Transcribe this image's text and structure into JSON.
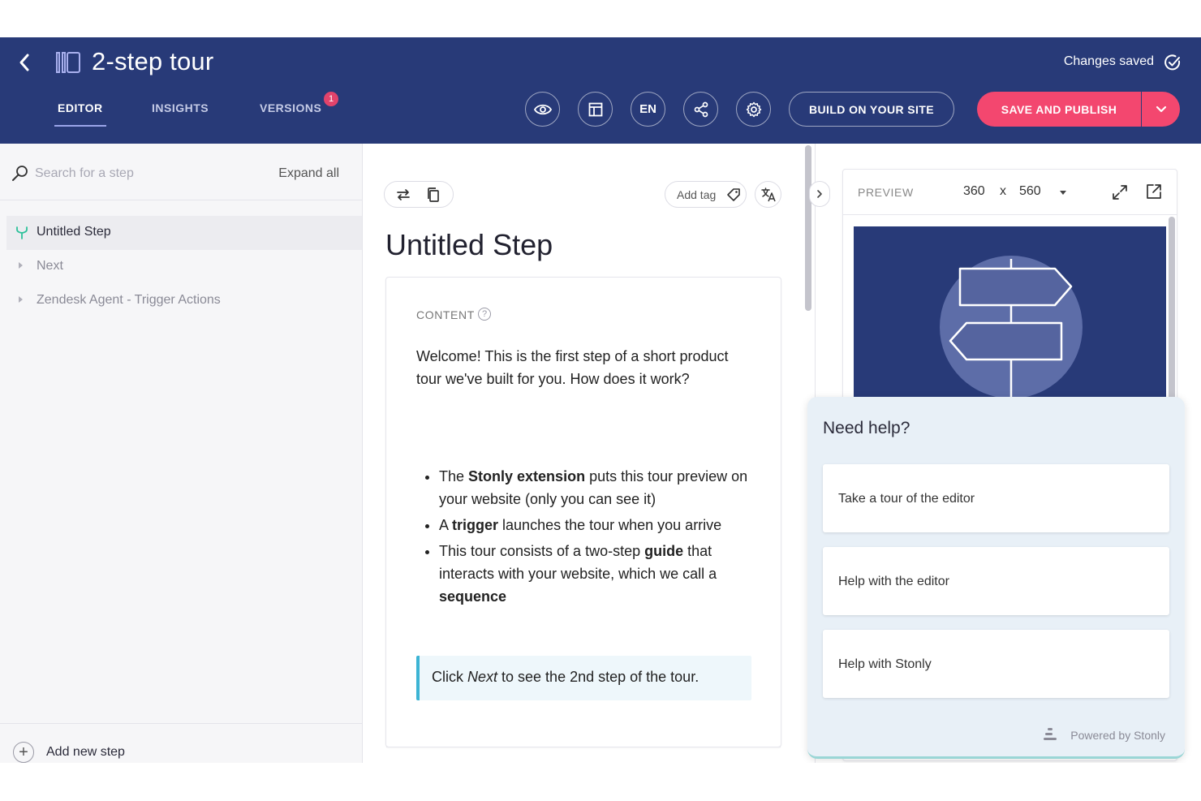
{
  "header": {
    "title": "2-step tour",
    "status": "Changes saved",
    "tabs": [
      {
        "label": "EDITOR",
        "active": true
      },
      {
        "label": "INSIGHTS",
        "active": false
      },
      {
        "label": "VERSIONS",
        "active": false
      }
    ],
    "versions_badge": "1",
    "language_button": "EN",
    "build_button": "BUILD ON YOUR SITE",
    "publish_button": "SAVE AND PUBLISH",
    "icons": [
      "back-icon",
      "guide-layout-icon",
      "check-circle-icon",
      "eye-icon",
      "layout-icon",
      "share-icon",
      "gear-icon",
      "chevron-down-icon"
    ],
    "colors": {
      "header_bg": "#283a78",
      "publish_bg": "#f3476f",
      "badge_bg": "#e2436b"
    }
  },
  "sidebar": {
    "search_placeholder": "Search for a step",
    "expand_all": "Expand all",
    "steps": [
      {
        "label": "Untitled Step",
        "active": true
      },
      {
        "label": "Next",
        "active": false
      },
      {
        "label": "Zendesk Agent - Trigger Actions",
        "active": false
      }
    ],
    "add_step": "Add new step"
  },
  "editor": {
    "add_tag": "Add tag",
    "step_title": "Untitled Step",
    "content_label": "CONTENT",
    "content_help": "?",
    "intro": "Welcome! This is the first step of a short product tour we've built for you. How does it work?",
    "bullets": [
      {
        "pre": "The ",
        "bold": "Stonly extension",
        "post": " puts this tour preview on your website (only you can see it)"
      },
      {
        "pre": "A ",
        "bold": "trigger",
        "post": " launches the tour when you arrive"
      },
      {
        "pre": "This tour consists of a two-step ",
        "bold": "guide",
        "post": " that interacts with your website, which we call a ",
        "bold2": "sequence"
      }
    ],
    "callout": {
      "pre": "Click ",
      "italic": "Next",
      "post": " to see the 2nd step of the tour."
    },
    "colors": {
      "callout_border": "#3cb4d4",
      "callout_bg": "#eef7fb"
    }
  },
  "preview": {
    "label": "PREVIEW",
    "width": "360",
    "separator": "x",
    "height": "560"
  },
  "help": {
    "title": "Need help?",
    "options": [
      "Take a tour of the editor",
      "Help with the editor",
      "Help with Stonly"
    ],
    "powered_by": "Powered by Stonly"
  }
}
